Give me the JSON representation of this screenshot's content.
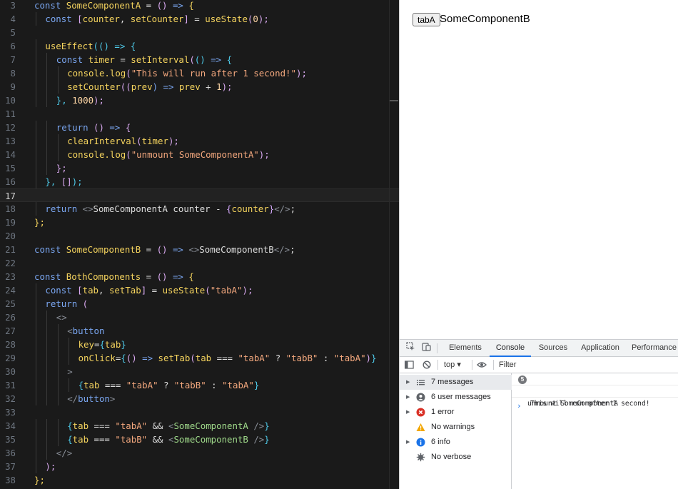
{
  "colors": {
    "keyword": "#7aa6f0",
    "name": "#f4d35e",
    "paren": "#d9a9f0",
    "string": "#f2a77d",
    "plain": "#dcdcdc",
    "number": "#ffd7a6",
    "tag": "#8a8f98",
    "jsx": "#9fd98a",
    "brace": "#cfa4f5",
    "cyan": "#4ec9e8",
    "comment": "#6e7681"
  },
  "editor": {
    "current_line": 17,
    "lines": [
      {
        "n": "3",
        "indent": 0,
        "tokens": [
          [
            "const ",
            "keyword"
          ],
          [
            "SomeComponentA",
            "name"
          ],
          [
            " = ",
            "plain"
          ],
          [
            "()",
            "paren"
          ],
          [
            " => ",
            "keyword"
          ],
          [
            "{",
            "name"
          ]
        ]
      },
      {
        "n": "4",
        "indent": 1,
        "tokens": [
          [
            "const ",
            "keyword"
          ],
          [
            "[",
            "paren"
          ],
          [
            "counter",
            "name"
          ],
          [
            ", ",
            "plain"
          ],
          [
            "setCounter",
            "name"
          ],
          [
            "]",
            "paren"
          ],
          [
            " = ",
            "plain"
          ],
          [
            "useState",
            "name"
          ],
          [
            "(",
            "paren"
          ],
          [
            "0",
            "number"
          ],
          [
            ");",
            "paren"
          ]
        ]
      },
      {
        "n": "5",
        "indent": 0,
        "tokens": []
      },
      {
        "n": "6",
        "indent": 1,
        "tokens": [
          [
            "useEffect",
            "name"
          ],
          [
            "(() => {",
            "cyan"
          ]
        ]
      },
      {
        "n": "7",
        "indent": 2,
        "tokens": [
          [
            "const ",
            "keyword"
          ],
          [
            "timer",
            "name"
          ],
          [
            " = ",
            "plain"
          ],
          [
            "setInterval",
            "name"
          ],
          [
            "(",
            "paren"
          ],
          [
            "() ",
            "cyan"
          ],
          [
            "=> ",
            "keyword"
          ],
          [
            "{",
            "cyan"
          ]
        ]
      },
      {
        "n": "8",
        "indent": 3,
        "tokens": [
          [
            "console",
            "name"
          ],
          [
            ".log",
            "name"
          ],
          [
            "(",
            "paren"
          ],
          [
            "\"This will run after 1 second!\"",
            "string"
          ],
          [
            ");",
            "paren"
          ]
        ]
      },
      {
        "n": "9",
        "indent": 3,
        "tokens": [
          [
            "setCounter",
            "name"
          ],
          [
            "((",
            "paren"
          ],
          [
            "prev",
            "name"
          ],
          [
            ") => ",
            "keyword"
          ],
          [
            "prev",
            "name"
          ],
          [
            " + ",
            "plain"
          ],
          [
            "1",
            "number"
          ],
          [
            ");",
            "paren"
          ]
        ]
      },
      {
        "n": "10",
        "indent": 2,
        "tokens": [
          [
            "}, ",
            "cyan"
          ],
          [
            "1000",
            "number"
          ],
          [
            ");",
            "paren"
          ]
        ]
      },
      {
        "n": "11",
        "indent": 0,
        "tokens": []
      },
      {
        "n": "12",
        "indent": 2,
        "tokens": [
          [
            "return ",
            "keyword"
          ],
          [
            "() ",
            "paren"
          ],
          [
            "=> ",
            "keyword"
          ],
          [
            "{",
            "paren"
          ]
        ]
      },
      {
        "n": "13",
        "indent": 3,
        "tokens": [
          [
            "clearInterval",
            "name"
          ],
          [
            "(",
            "paren"
          ],
          [
            "timer",
            "name"
          ],
          [
            ");",
            "paren"
          ]
        ]
      },
      {
        "n": "14",
        "indent": 3,
        "tokens": [
          [
            "console",
            "name"
          ],
          [
            ".log",
            "name"
          ],
          [
            "(",
            "paren"
          ],
          [
            "\"unmount SomeComponentA\"",
            "string"
          ],
          [
            ");",
            "paren"
          ]
        ]
      },
      {
        "n": "15",
        "indent": 2,
        "tokens": [
          [
            "};",
            "paren"
          ]
        ]
      },
      {
        "n": "16",
        "indent": 1,
        "tokens": [
          [
            "}, ",
            "cyan"
          ],
          [
            "[]",
            "paren"
          ],
          [
            ");",
            "cyan"
          ]
        ]
      },
      {
        "n": "17",
        "indent": 0,
        "tokens": []
      },
      {
        "n": "18",
        "indent": 1,
        "tokens": [
          [
            "return ",
            "keyword"
          ],
          [
            "<>",
            "tag"
          ],
          [
            "SomeComponentA counter - ",
            "plain"
          ],
          [
            "{",
            "brace"
          ],
          [
            "counter",
            "name"
          ],
          [
            "}",
            "brace"
          ],
          [
            "</>",
            "tag"
          ],
          [
            ";",
            "plain"
          ]
        ]
      },
      {
        "n": "19",
        "indent": 0,
        "tokens": [
          [
            "};",
            "name"
          ]
        ]
      },
      {
        "n": "20",
        "indent": 0,
        "tokens": []
      },
      {
        "n": "21",
        "indent": 0,
        "tokens": [
          [
            "const ",
            "keyword"
          ],
          [
            "SomeComponentB",
            "name"
          ],
          [
            " = ",
            "plain"
          ],
          [
            "()",
            "paren"
          ],
          [
            " => ",
            "keyword"
          ],
          [
            "<>",
            "tag"
          ],
          [
            "SomeComponentB",
            "plain"
          ],
          [
            "</>",
            "tag"
          ],
          [
            ";",
            "plain"
          ]
        ]
      },
      {
        "n": "22",
        "indent": 0,
        "tokens": []
      },
      {
        "n": "23",
        "indent": 0,
        "tokens": [
          [
            "const ",
            "keyword"
          ],
          [
            "BothComponents",
            "name"
          ],
          [
            " = ",
            "plain"
          ],
          [
            "()",
            "paren"
          ],
          [
            " => ",
            "keyword"
          ],
          [
            "{",
            "name"
          ]
        ]
      },
      {
        "n": "24",
        "indent": 1,
        "tokens": [
          [
            "const ",
            "keyword"
          ],
          [
            "[",
            "paren"
          ],
          [
            "tab",
            "name"
          ],
          [
            ", ",
            "plain"
          ],
          [
            "setTab",
            "name"
          ],
          [
            "]",
            "paren"
          ],
          [
            " = ",
            "plain"
          ],
          [
            "useState",
            "name"
          ],
          [
            "(",
            "paren"
          ],
          [
            "\"tabA\"",
            "string"
          ],
          [
            ");",
            "paren"
          ]
        ]
      },
      {
        "n": "25",
        "indent": 1,
        "tokens": [
          [
            "return ",
            "keyword"
          ],
          [
            "(",
            "paren"
          ]
        ]
      },
      {
        "n": "26",
        "indent": 2,
        "tokens": [
          [
            "<>",
            "tag"
          ]
        ]
      },
      {
        "n": "27",
        "indent": 3,
        "tokens": [
          [
            "<",
            "tag"
          ],
          [
            "button",
            "keyword"
          ]
        ]
      },
      {
        "n": "28",
        "indent": 4,
        "tokens": [
          [
            "key",
            "name"
          ],
          [
            "=",
            "plain"
          ],
          [
            "{",
            "cyan"
          ],
          [
            "tab",
            "name"
          ],
          [
            "}",
            "cyan"
          ]
        ]
      },
      {
        "n": "29",
        "indent": 4,
        "tokens": [
          [
            "onClick",
            "name"
          ],
          [
            "=",
            "plain"
          ],
          [
            "{",
            "cyan"
          ],
          [
            "() ",
            "paren"
          ],
          [
            "=> ",
            "keyword"
          ],
          [
            "setTab",
            "name"
          ],
          [
            "(",
            "paren"
          ],
          [
            "tab",
            "name"
          ],
          [
            " === ",
            "plain"
          ],
          [
            "\"tabA\"",
            "string"
          ],
          [
            " ? ",
            "plain"
          ],
          [
            "\"tabB\"",
            "string"
          ],
          [
            " : ",
            "plain"
          ],
          [
            "\"tabA\"",
            "string"
          ],
          [
            ")",
            "paren"
          ],
          [
            "}",
            "cyan"
          ]
        ]
      },
      {
        "n": "30",
        "indent": 3,
        "tokens": [
          [
            ">",
            "tag"
          ]
        ]
      },
      {
        "n": "31",
        "indent": 4,
        "tokens": [
          [
            "{",
            "cyan"
          ],
          [
            "tab",
            "name"
          ],
          [
            " === ",
            "plain"
          ],
          [
            "\"tabA\"",
            "string"
          ],
          [
            " ? ",
            "plain"
          ],
          [
            "\"tabB\"",
            "string"
          ],
          [
            " : ",
            "plain"
          ],
          [
            "\"tabA\"",
            "string"
          ],
          [
            "}",
            "cyan"
          ]
        ]
      },
      {
        "n": "32",
        "indent": 3,
        "tokens": [
          [
            "</",
            "tag"
          ],
          [
            "button",
            "keyword"
          ],
          [
            ">",
            "tag"
          ]
        ]
      },
      {
        "n": "33",
        "indent": 0,
        "tokens": []
      },
      {
        "n": "34",
        "indent": 3,
        "tokens": [
          [
            "{",
            "cyan"
          ],
          [
            "tab",
            "name"
          ],
          [
            " === ",
            "plain"
          ],
          [
            "\"tabA\"",
            "string"
          ],
          [
            " && ",
            "plain"
          ],
          [
            "<",
            "tag"
          ],
          [
            "SomeComponentA",
            "jsx"
          ],
          [
            " />",
            "tag"
          ],
          [
            "}",
            "cyan"
          ]
        ]
      },
      {
        "n": "35",
        "indent": 3,
        "tokens": [
          [
            "{",
            "cyan"
          ],
          [
            "tab",
            "name"
          ],
          [
            " === ",
            "plain"
          ],
          [
            "\"tabB\"",
            "string"
          ],
          [
            " && ",
            "plain"
          ],
          [
            "<",
            "tag"
          ],
          [
            "SomeComponentB",
            "jsx"
          ],
          [
            " />",
            "tag"
          ],
          [
            "}",
            "cyan"
          ]
        ]
      },
      {
        "n": "36",
        "indent": 2,
        "tokens": [
          [
            "</>",
            "tag"
          ]
        ]
      },
      {
        "n": "37",
        "indent": 1,
        "tokens": [
          [
            ");",
            "paren"
          ]
        ]
      },
      {
        "n": "38",
        "indent": 0,
        "tokens": [
          [
            "};",
            "name"
          ]
        ]
      }
    ]
  },
  "page": {
    "button_label": "tabA",
    "component_text": "SomeComponentB"
  },
  "devtools": {
    "tabs": [
      "Elements",
      "Console",
      "Sources",
      "Application",
      "Performance"
    ],
    "active_tab": "Console",
    "context": "top ▾",
    "filter_placeholder": "Filter",
    "sidebar": [
      {
        "arrow": true,
        "icon": "list-icon",
        "label": "7 messages",
        "selected": true
      },
      {
        "arrow": true,
        "icon": "user-icon",
        "label": "6 user messages",
        "selected": false
      },
      {
        "arrow": true,
        "icon": "error-icon",
        "label": "1 error",
        "selected": false
      },
      {
        "arrow": false,
        "icon": "warning-icon",
        "label": "No warnings",
        "selected": false
      },
      {
        "arrow": true,
        "icon": "info-icon",
        "label": "6 info",
        "selected": false
      },
      {
        "arrow": false,
        "icon": "verbose-icon",
        "label": "No verbose",
        "selected": false
      }
    ],
    "messages": [
      {
        "count": "5",
        "text": "This will run after 1 second!"
      },
      {
        "count": "",
        "text": "unmount SomeComponentA"
      }
    ],
    "prompt": "›"
  }
}
